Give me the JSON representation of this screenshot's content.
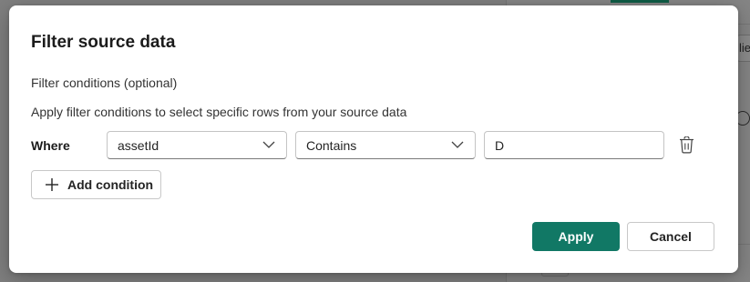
{
  "background": {
    "tab_fragment": "lie",
    "text_fragment": "d"
  },
  "dialog": {
    "title": "Filter source data",
    "section_label": "Filter conditions (optional)",
    "description": "Apply filter conditions to select specific rows from your source data",
    "condition": {
      "where_label": "Where",
      "field": "assetId",
      "operator": "Contains",
      "value": "D"
    },
    "add_condition_label": "Add condition",
    "apply_label": "Apply",
    "cancel_label": "Cancel"
  },
  "colors": {
    "primary": "#117865",
    "overlay": "#7f7f7f"
  },
  "icons": {
    "dropdown": "chevron-down-icon",
    "delete": "trash-icon",
    "add": "plus-icon"
  }
}
